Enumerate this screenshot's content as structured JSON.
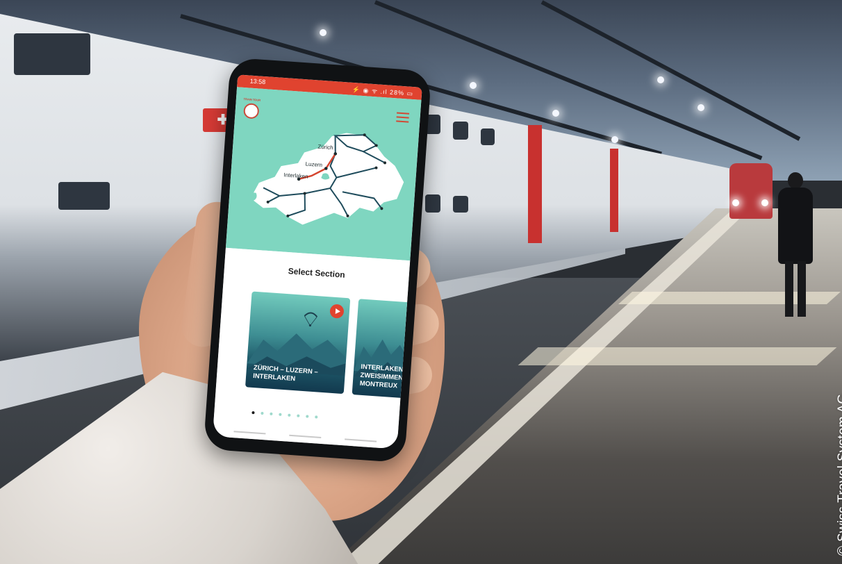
{
  "phone": {
    "status_time": "13:58",
    "status_icons": "⚡ ◉ ᯤ .ıl 28% ▭",
    "logo_text": "TRAIN TOUR",
    "map": {
      "labels": [
        "Zürich",
        "Luzern",
        "Interlaken"
      ],
      "route_color": "#d5452f",
      "network_color": "#1f4c5c",
      "land_color": "#ffffff",
      "background_color": "#7fd6c0"
    },
    "section_title": "Select Section",
    "cards": [
      {
        "label": "ZÜRICH – LUZERN – INTERLAKEN",
        "icon": "paraglider-icon",
        "has_play": true
      },
      {
        "label": "INTERLAKEN ZWEISIMMEN MONTREUX",
        "icon": "mountain-icon",
        "has_play": false
      }
    ],
    "pagination": {
      "count": 8,
      "active_index": 0
    },
    "accent_color": "#e0432f"
  },
  "photo": {
    "credit": "© Swiss Travel System AG"
  }
}
